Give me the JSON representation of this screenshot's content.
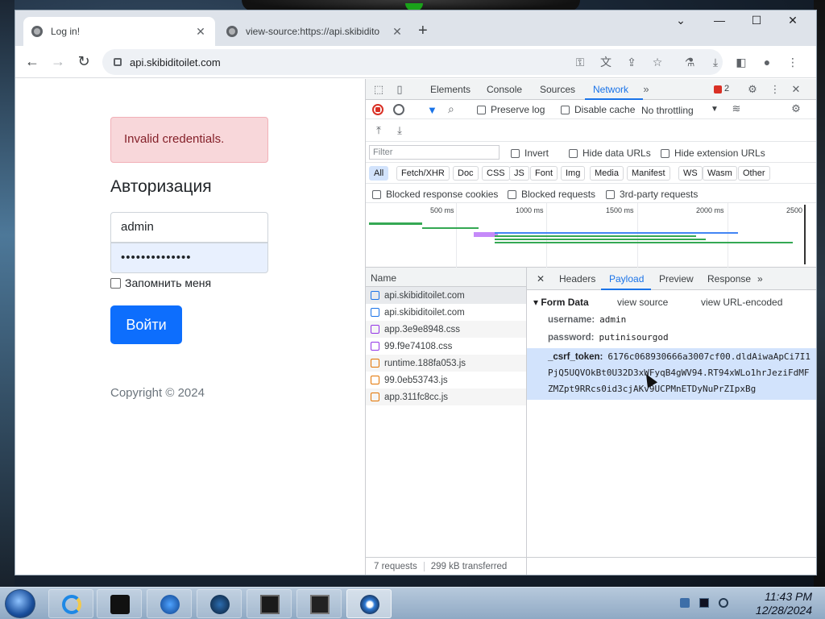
{
  "browser": {
    "tabs": [
      {
        "title": "Log in!",
        "active": true
      },
      {
        "title": "view-source:https://api.skibidito",
        "active": false
      }
    ],
    "address_bar": {
      "url": "api.skibiditoilet.com"
    }
  },
  "page": {
    "alert_text": "Invalid credentials.",
    "heading": "Авторизация",
    "username_value": "admin",
    "password_masked": "••••••••••••••",
    "remember_label": "Запомнить меня",
    "submit_label": "Войти",
    "copyright": "Copyright © 2024"
  },
  "devtools": {
    "tabs": [
      "Elements",
      "Console",
      "Sources",
      "Network"
    ],
    "active_tab": "Network",
    "issues_count": "2",
    "toolbar": {
      "preserve_log": "Preserve log",
      "disable_cache": "Disable cache",
      "throttling": "No throttling"
    },
    "filter_placeholder": "Filter",
    "filter_options": {
      "invert": "Invert",
      "hide_data_urls": "Hide data URLs",
      "hide_extension_urls": "Hide extension URLs"
    },
    "type_filters": [
      "All",
      "Fetch/XHR",
      "Doc",
      "CSS",
      "JS",
      "Font",
      "Img",
      "Media",
      "Manifest",
      "WS",
      "Wasm",
      "Other"
    ],
    "blocked_options": {
      "blocked_cookies": "Blocked response cookies",
      "blocked_requests": "Blocked requests",
      "third_party": "3rd-party requests"
    },
    "timeline_ticks": [
      "500 ms",
      "1000 ms",
      "1500 ms",
      "2000 ms",
      "2500"
    ],
    "request_list_header": "Name",
    "requests": [
      {
        "name": "api.skibiditoilet.com",
        "type": "doc"
      },
      {
        "name": "api.skibiditoilet.com",
        "type": "doc"
      },
      {
        "name": "app.3e9e8948.css",
        "type": "css"
      },
      {
        "name": "99.f9e74108.css",
        "type": "css"
      },
      {
        "name": "runtime.188fa053.js",
        "type": "js"
      },
      {
        "name": "99.0eb53743.js",
        "type": "js"
      },
      {
        "name": "app.311fc8cc.js",
        "type": "js"
      }
    ],
    "footer": {
      "requests": "7 requests",
      "transferred": "299 kB transferred"
    },
    "detail_tabs": [
      "Headers",
      "Payload",
      "Preview",
      "Response"
    ],
    "detail_active": "Payload",
    "form_data": {
      "heading": "Form Data",
      "view_source": "view source",
      "view_url_encoded": "view URL-encoded",
      "username_key": "username:",
      "username_value": "admin",
      "password_key": "password:",
      "password_value": "putinisourgod",
      "csrf_key": "_csrf_token:",
      "csrf_line1": "6176c068930666a3007cf00.dldAiwaApCi7I1",
      "csrf_line2": "PjQ5UQVOkBt0U32D3xWFyqB4gWV94.RT94xWLo1hrJeziFdMF",
      "csrf_line3": "ZMZpt9RRcs0id3cjAKv9UCPMnETDyNuPrZIpxBg"
    }
  },
  "taskbar": {
    "time": "11:43 PM",
    "date": "12/28/2024"
  },
  "colors": {
    "devtools_accent": "#1a73e8",
    "alert_bg": "#f8d7da",
    "primary_button": "#0d6efd"
  }
}
